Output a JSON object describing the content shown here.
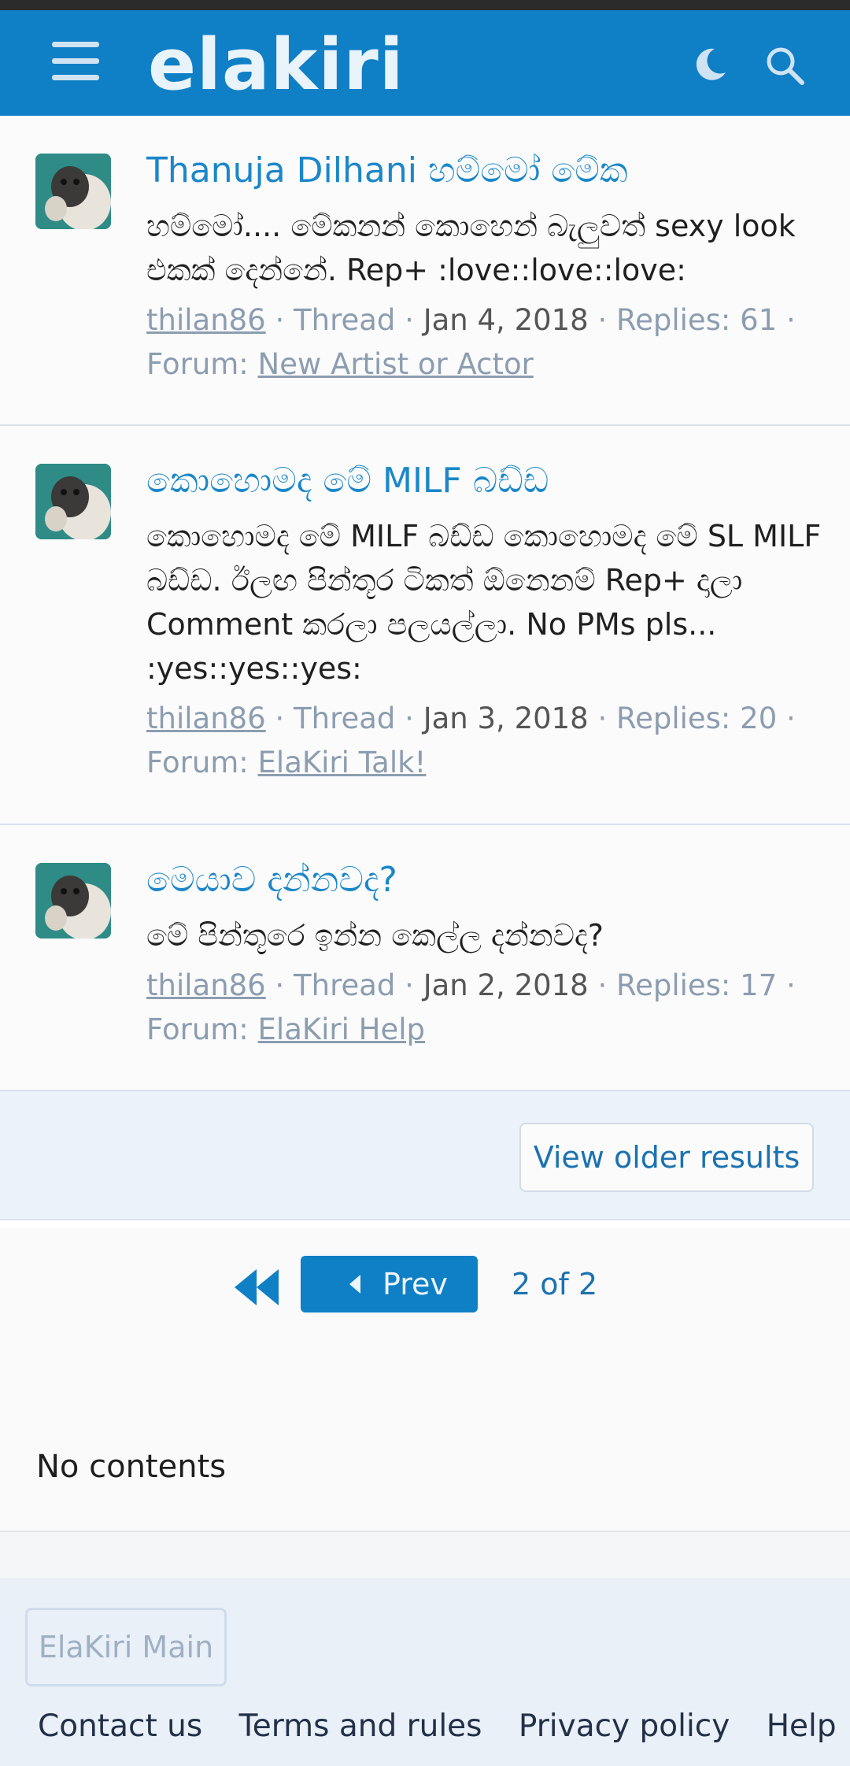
{
  "header": {
    "logo": "elakiri",
    "icons": [
      "menu-icon",
      "moon-icon",
      "search-icon"
    ],
    "colors": {
      "bar": "#0f7fc6",
      "link": "#1b87c9"
    }
  },
  "results": [
    {
      "title": "Thanuja Dilhani හම්මෝ මේක",
      "snippet": "හම්මෝ.... මේකනන් කොහෙන් බැලුවත් sexy look එකක් දෙන්නේ. Rep+ :love::love::love:",
      "user": "thilan86",
      "type": "Thread",
      "date": "Jan 4, 2018",
      "replies": "Replies: 61",
      "forum_label": "Forum:",
      "forum": "New Artist or Actor"
    },
    {
      "title": "කොහොමද මේ MILF බඩ්ඩ",
      "snippet": "කොහොමද මේ MILF බඩ්ඩ කොහොමද මේ SL MILF බඩ්ඩ. ඊලඟ පින්තූර ටිකත් ඕනෙනම් Rep+ දාලා Comment කරලා පලයල්ලා. No PMs pls... :yes::yes::yes:",
      "user": "thilan86",
      "type": "Thread",
      "date": "Jan 3, 2018",
      "replies": "Replies: 20",
      "forum_label": "Forum:",
      "forum": "ElaKiri Talk!"
    },
    {
      "title": "මෙයාව දන්නවද?",
      "snippet": "මේ පින්තූරෙ ඉන්න කෙල්ල දන්නවද?",
      "user": "thilan86",
      "type": "Thread",
      "date": "Jan 2, 2018",
      "replies": "Replies: 17",
      "forum_label": "Forum:",
      "forum": "ElaKiri Help"
    }
  ],
  "older_results": "View older results",
  "pager": {
    "prev": "Prev",
    "count": "2 of 2"
  },
  "no_contents": "No contents",
  "footer": {
    "main": "ElaKiri Main",
    "links": [
      "Contact us",
      "Terms and rules",
      "Privacy policy",
      "Help"
    ]
  }
}
